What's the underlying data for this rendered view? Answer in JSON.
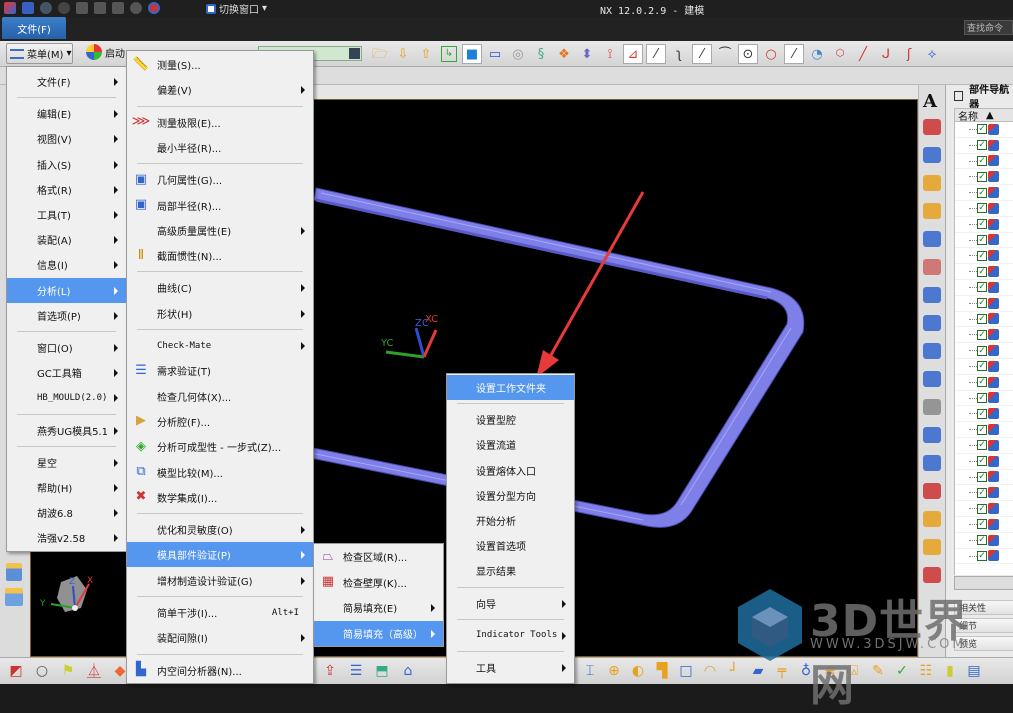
{
  "app": {
    "title": "NX 12.0.2.9 - 建模",
    "switch_window": "切换窗口",
    "find_command": "查找命令",
    "file_tab": "文件(F)"
  },
  "toolbar": {
    "menu_button": "菜单(M)",
    "start_button": "启动"
  },
  "main_menu": {
    "items": [
      {
        "label": "文件(F)",
        "submenu": true
      },
      {
        "label": "编辑(E)",
        "submenu": true
      },
      {
        "label": "视图(V)",
        "submenu": true
      },
      {
        "label": "插入(S)",
        "submenu": true
      },
      {
        "label": "格式(R)",
        "submenu": true
      },
      {
        "label": "工具(T)",
        "submenu": true
      },
      {
        "label": "装配(A)",
        "submenu": true
      },
      {
        "label": "信息(I)",
        "submenu": true
      },
      {
        "label": "分析(L)",
        "submenu": true,
        "highlighted": true
      },
      {
        "label": "首选项(P)",
        "submenu": true
      },
      {
        "label": "窗口(O)",
        "submenu": true
      },
      {
        "label": "GC工具箱",
        "submenu": true
      },
      {
        "label": "HB_MOULD(2.0)",
        "submenu": true
      },
      {
        "label": "燕秀UG模具5.1",
        "submenu": true
      },
      {
        "label": "星空",
        "submenu": true
      },
      {
        "label": "帮助(H)",
        "submenu": true
      },
      {
        "label": "胡波6.8",
        "submenu": true
      },
      {
        "label": "浩强v2.58",
        "submenu": true
      }
    ]
  },
  "analysis_menu": {
    "items": [
      {
        "label": "测量(S)...",
        "icon": "ruler-icon"
      },
      {
        "label": "偏差(V)",
        "submenu": true
      },
      {
        "label": "测量极限(E)...",
        "icon": "measure-limit-icon"
      },
      {
        "label": "最小半径(R)..."
      },
      {
        "label": "几何属性(G)...",
        "icon": "geometry-props-icon"
      },
      {
        "label": "局部半径(R)...",
        "icon": "local-radius-icon"
      },
      {
        "label": "高级质量属性(E)",
        "submenu": true
      },
      {
        "label": "截面惯性(N)...",
        "icon": "section-inertia-icon"
      },
      {
        "label": "曲线(C)",
        "submenu": true
      },
      {
        "label": "形状(H)",
        "submenu": true
      },
      {
        "label": "Check-Mate",
        "submenu": true
      },
      {
        "label": "需求验证(T)",
        "icon": "requirements-icon"
      },
      {
        "label": "检查几何体(X)..."
      },
      {
        "label": "分析腔(F)...",
        "icon": "cavity-icon"
      },
      {
        "label": "分析可成型性 - 一步式(Z)...",
        "icon": "formability-icon"
      },
      {
        "label": "模型比较(M)...",
        "icon": "model-compare-icon"
      },
      {
        "label": "数学集成(I)...",
        "icon": "math-integration-icon"
      },
      {
        "label": "优化和灵敏度(O)",
        "submenu": true
      },
      {
        "label": "模具部件验证(P)",
        "submenu": true,
        "highlighted": true
      },
      {
        "label": "增材制造设计验证(G)",
        "submenu": true
      },
      {
        "label": "简单干涉(I)...",
        "shortcut": "Alt+I"
      },
      {
        "label": "装配间隙(I)",
        "submenu": true
      },
      {
        "label": "内空间分析器(N)...",
        "icon": "space-analyzer-icon"
      }
    ]
  },
  "mold_menu": {
    "items": [
      {
        "label": "检查区域(R)...",
        "icon": "check-region-icon"
      },
      {
        "label": "检查壁厚(K)...",
        "icon": "wall-thickness-icon"
      },
      {
        "label": "简易填充(E)",
        "submenu": true
      },
      {
        "label": "简易填充（高级）",
        "submenu": true,
        "highlighted": true
      }
    ]
  },
  "fill_menu": {
    "items": [
      {
        "label": "设置工作文件夹",
        "highlighted": true
      },
      {
        "label": "设置型腔"
      },
      {
        "label": "设置流道"
      },
      {
        "label": "设置熔体入口"
      },
      {
        "label": "设置分型方向"
      },
      {
        "label": "开始分析"
      },
      {
        "label": "设置首选项"
      },
      {
        "label": "显示结果"
      },
      {
        "label": "向导",
        "submenu": true
      },
      {
        "label": "Indicator Tools",
        "submenu": true
      },
      {
        "label": "工具",
        "submenu": true
      }
    ]
  },
  "part_navigator": {
    "title": "部件导航器",
    "column_name": "名称",
    "rows": 28,
    "sections": [
      "相关性",
      "细节",
      "预览"
    ]
  },
  "viewport": {
    "axes": {
      "x": "XC",
      "y": "YC",
      "z": "ZC"
    },
    "triad": {
      "x": "X",
      "y": "Y",
      "z": "Z"
    }
  },
  "watermark": {
    "text": "3D世界网",
    "url": "WWW.3DSJW.COM"
  },
  "colors": {
    "highlight": "#5596ee",
    "model": "#7f7fe8",
    "annotation_arrow": "#e83a3a",
    "file_tab": "#2d6cb5"
  }
}
